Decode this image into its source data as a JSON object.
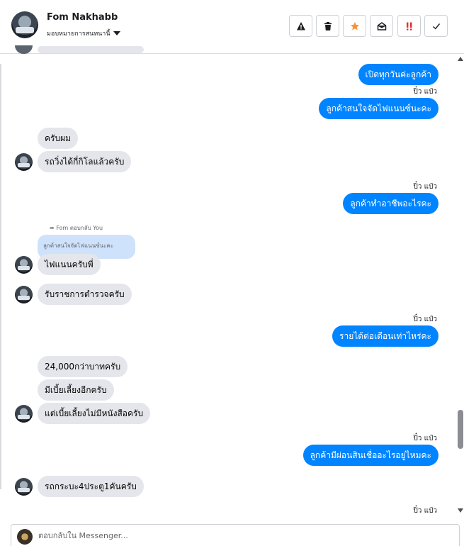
{
  "header": {
    "contact_name": "Fom Nakhabb",
    "assign_label": "มอบหมายการสนทนานี้",
    "tools": [
      {
        "icon": "warning-icon",
        "label": "Mark as spam"
      },
      {
        "icon": "trash-icon",
        "label": "Delete"
      },
      {
        "icon": "star-icon",
        "label": "Star"
      },
      {
        "icon": "mark-unread-icon",
        "label": "Mark as unread"
      },
      {
        "icon": "follow-up-icon",
        "label": "Follow up"
      },
      {
        "icon": "check-icon",
        "label": "Done"
      }
    ]
  },
  "colors": {
    "outgoing": "#0084ff",
    "incoming": "#e4e6eb",
    "star": "#f7923b",
    "follow_up": "#e02f2f"
  },
  "messages": [
    {
      "dir": "out",
      "text": "เปิดทุกวันค่ะลูกค้า"
    },
    {
      "dir": "seen",
      "text": "ปิ๋ว แป๋ว"
    },
    {
      "dir": "out",
      "text": "ลูกค้าสนใจจัดไฟแนนซ์นะคะ"
    },
    {
      "dir": "in",
      "text": "ครับผม"
    },
    {
      "dir": "in",
      "text": "รถวิ่งได้กี่กิโลแล้วครับ"
    },
    {
      "dir": "seen",
      "text": "ปิ๋ว แป๋ว"
    },
    {
      "dir": "out",
      "text": "ลูกค้าทำอาชีพอะไรคะ"
    },
    {
      "dir": "reply_note",
      "text": "Fom ตอบกลับ You"
    },
    {
      "dir": "quoted",
      "text": "ลูกค้าสนใจจัดไฟแนนซ์นะคะ"
    },
    {
      "dir": "in",
      "text": "ไฟแนนครับพี่"
    },
    {
      "dir": "in",
      "text": "รับราชการตำรวจครับ"
    },
    {
      "dir": "seen",
      "text": "ปิ๋ว แป๋ว"
    },
    {
      "dir": "out",
      "text": "รายได้ต่อเดือนเท่าไหร่คะ"
    },
    {
      "dir": "in",
      "text": "24,000กว่าบาทครับ"
    },
    {
      "dir": "in",
      "text": "มีเบี้ยเลี้ยงอีกครับ"
    },
    {
      "dir": "in",
      "text": "แต่เบี้ยเลี้ยงไม่มีหนังสือครับ"
    },
    {
      "dir": "seen",
      "text": "ปิ๋ว แป๋ว"
    },
    {
      "dir": "out",
      "text": "ลูกค้ามีผ่อนสินเชื่ออะไรอยู่ไหมคะ"
    },
    {
      "dir": "in",
      "text": "รถกระบะ4ประตู1คันครับ"
    },
    {
      "dir": "seen",
      "text": "ปิ๋ว แป๋ว"
    }
  ],
  "composer": {
    "placeholder": "ตอบกลับใน Messenger..."
  }
}
